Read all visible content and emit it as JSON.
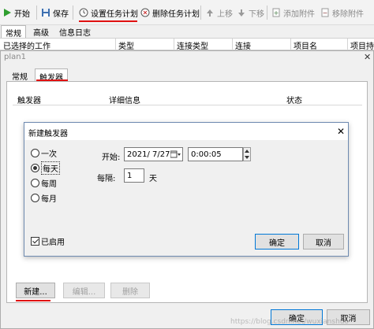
{
  "toolbar": {
    "start": "开始",
    "save": "保存",
    "set_schedule": "设置任务计划",
    "delete_schedule": "删除任务计划",
    "move_up": "上移",
    "move_down": "下移",
    "add_attachment": "添加附件",
    "remove_attachment": "移除附件"
  },
  "tabs": [
    "常规",
    "高级",
    "信息日志"
  ],
  "list_columns": [
    "已选择的工作",
    "类型",
    "连接类型",
    "连接",
    "项目名",
    "项目持"
  ],
  "prop_window": {
    "title": "plan1",
    "close": "✕",
    "tabs": [
      "常规",
      "触发器"
    ]
  },
  "trigger_table": {
    "columns": [
      "触发器",
      "详细信息",
      "状态"
    ]
  },
  "pane_buttons": {
    "new": "新建...",
    "edit": "编辑...",
    "delete": "删除"
  },
  "bottom_buttons": {
    "ok": "确定",
    "cancel": "取消"
  },
  "dialog": {
    "title": "新建触发器",
    "close": "✕",
    "options": [
      "一次",
      "每天",
      "每周",
      "每月"
    ],
    "selected": "每天",
    "start_label": "开始:",
    "start_date": "2021/ 7/27",
    "start_time": "0:00:05",
    "interval_label": "每隔:",
    "interval_value": "1",
    "interval_unit": "天",
    "enabled_label": "已启用",
    "ok": "确定",
    "cancel": "取消"
  },
  "watermark": "https://blog.csdn.net/wuxianshuo"
}
